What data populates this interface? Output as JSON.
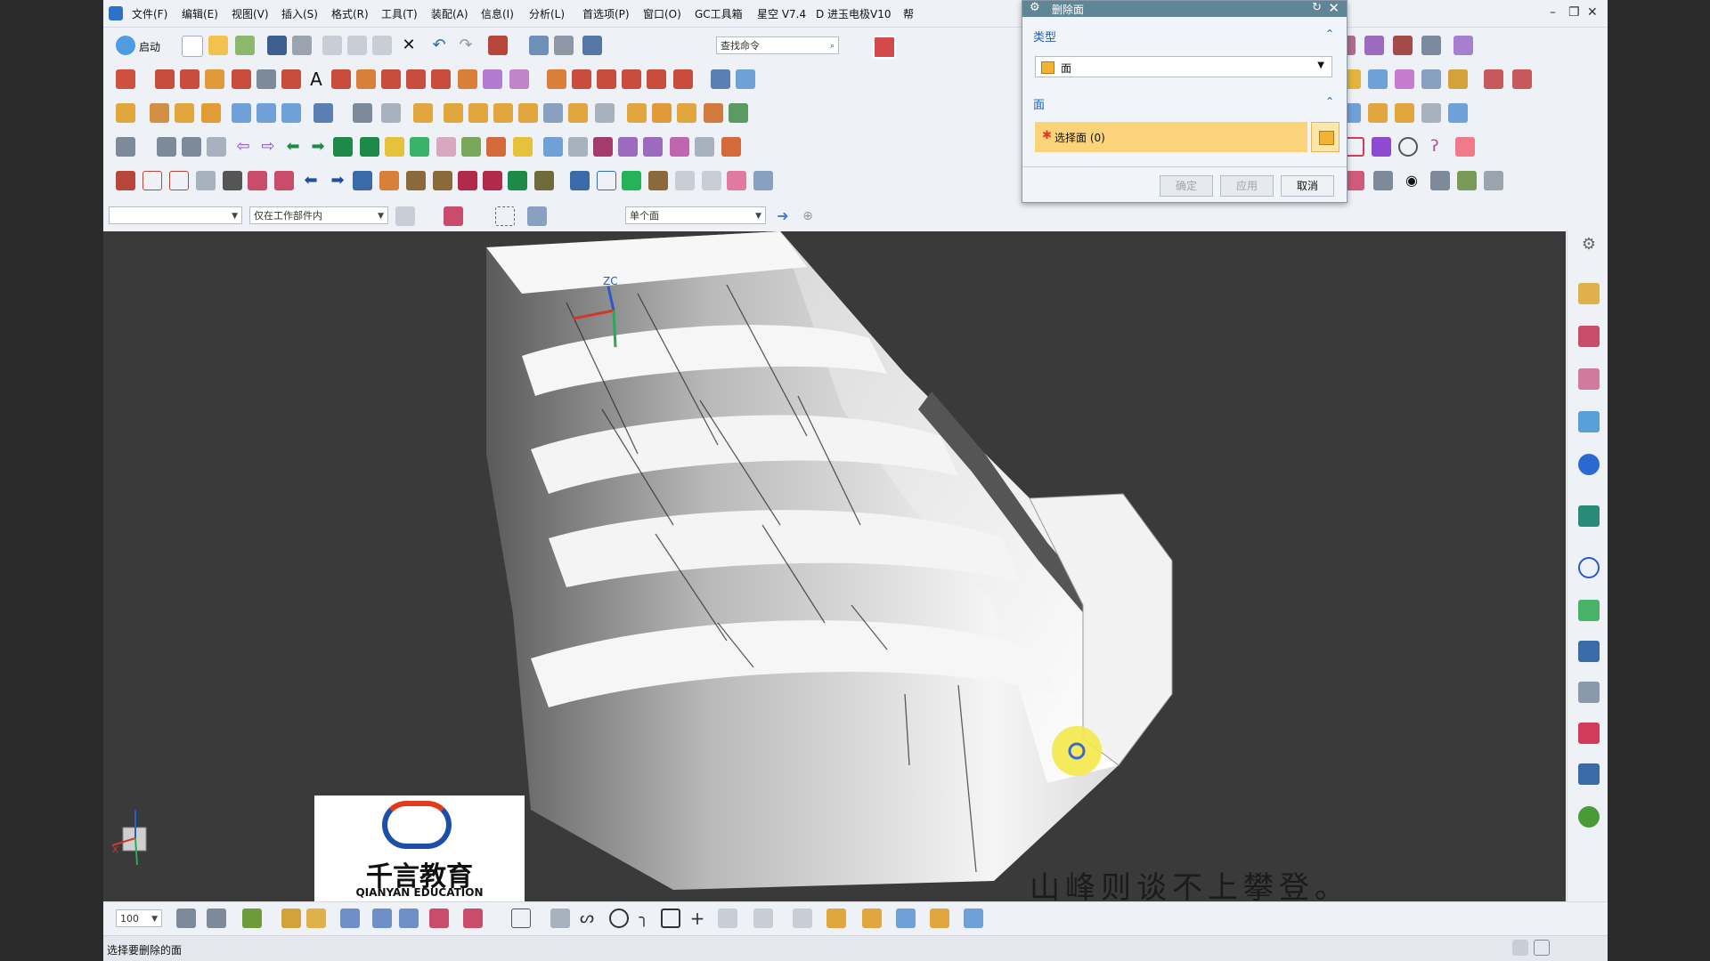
{
  "menu": [
    "文件(F)",
    "编辑(E)",
    "视图(V)",
    "插入(S)",
    "格式(R)",
    "工具(T)",
    "装配(A)",
    "信息(I)",
    "分析(L)",
    "首选项(P)",
    "窗口(O)",
    "GC工具箱",
    "星空 V7.4",
    "D 进玉电极V10",
    "帮"
  ],
  "toolbar": {
    "start_label": "启动",
    "search_placeholder": "查找命令",
    "filter_value": "",
    "scope_value": "仅在工作部件内",
    "face_rule_value": "单个面",
    "zoom_value": "100"
  },
  "dialog": {
    "title": "删除面",
    "type_group": "类型",
    "type_value": "面",
    "face_group": "面",
    "select_face": "选择面 (0)",
    "ok": "确定",
    "apply": "应用",
    "cancel": "取消"
  },
  "viewport": {
    "axis_label": "ZC",
    "triad_x": "X",
    "subtitle": "山峰则谈不上攀登。",
    "watermark_brand": "千言教育",
    "watermark_en": "QIANYAN EDUCATION"
  },
  "status": {
    "message": "选择要删除的面"
  },
  "colors": {
    "dialog_title": "#5f8696",
    "selection_row": "#fad37a",
    "viewport_bg": "#3a3a3a"
  }
}
